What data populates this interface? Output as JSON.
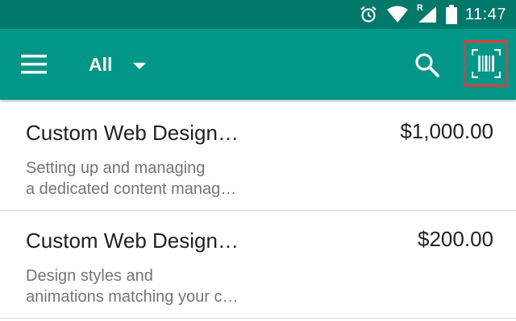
{
  "status_bar": {
    "time": "11:47",
    "icons": [
      "alarm-icon",
      "wifi-icon",
      "signal-roaming-icon",
      "battery-icon"
    ],
    "roaming_letter": "R"
  },
  "app_bar": {
    "filter_label": "All",
    "menu_icon": "hamburger-menu-icon",
    "search_icon": "search-icon",
    "barcode_icon": "barcode-scan-icon"
  },
  "items": [
    {
      "title": "Custom Web Design…",
      "price": "$1,000.00",
      "desc_line1": "Setting up and managing",
      "desc_line2": "a dedicated content manag…"
    },
    {
      "title": "Custom Web Design…",
      "price": "$200.00",
      "desc_line1": "Design styles and",
      "desc_line2": "animations matching your c…"
    }
  ],
  "colors": {
    "status_bar": "#00796b",
    "app_bar": "#009688",
    "highlight": "#e53935"
  }
}
